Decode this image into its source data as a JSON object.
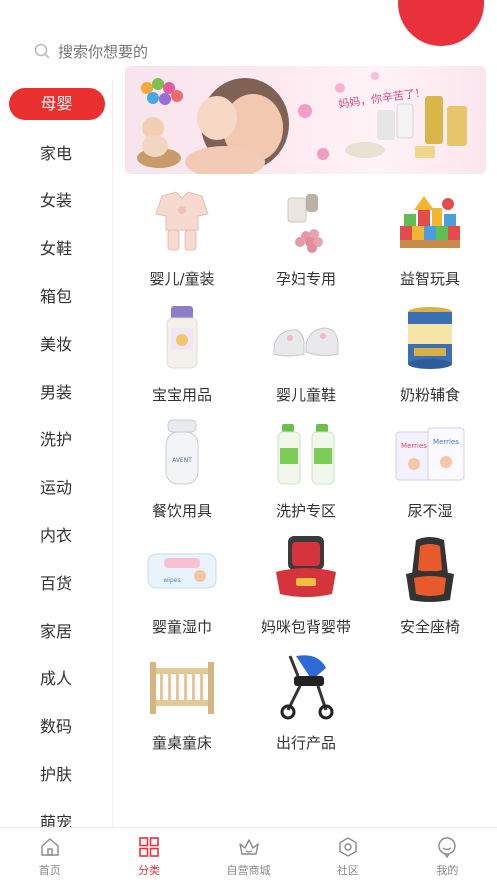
{
  "search": {
    "placeholder": "搜索你想要的",
    "button_label": "搜索"
  },
  "sidebar": {
    "items": [
      {
        "label": "母婴",
        "active": true
      },
      {
        "label": "家电"
      },
      {
        "label": "女装"
      },
      {
        "label": "女鞋"
      },
      {
        "label": "箱包"
      },
      {
        "label": "美妆"
      },
      {
        "label": "男装"
      },
      {
        "label": "洗护"
      },
      {
        "label": "运动"
      },
      {
        "label": "内衣"
      },
      {
        "label": "百货"
      },
      {
        "label": "家居"
      },
      {
        "label": "成人"
      },
      {
        "label": "数码"
      },
      {
        "label": "护肤"
      },
      {
        "label": "萌宠"
      }
    ]
  },
  "banner": {
    "slogan": "妈妈，你辛苦了！"
  },
  "grid": {
    "items": [
      {
        "label": "婴儿/童装",
        "icon": "baby-clothes-icon"
      },
      {
        "label": "孕妇专用",
        "icon": "maternity-supplement-icon"
      },
      {
        "label": "益智玩具",
        "icon": "building-blocks-icon"
      },
      {
        "label": "宝宝用品",
        "icon": "baby-lotion-icon"
      },
      {
        "label": "婴儿童鞋",
        "icon": "baby-shoes-icon"
      },
      {
        "label": "奶粉辅食",
        "icon": "milk-powder-can-icon"
      },
      {
        "label": "餐饮用具",
        "icon": "baby-bottle-icon"
      },
      {
        "label": "洗护专区",
        "icon": "detergent-bottles-icon"
      },
      {
        "label": "尿不湿",
        "icon": "diaper-pack-icon"
      },
      {
        "label": "婴童湿巾",
        "icon": "wet-wipes-icon"
      },
      {
        "label": "妈咪包背婴带",
        "icon": "baby-carrier-icon"
      },
      {
        "label": "安全座椅",
        "icon": "car-seat-icon"
      },
      {
        "label": "童桌童床",
        "icon": "baby-crib-icon"
      },
      {
        "label": "出行产品",
        "icon": "stroller-icon"
      }
    ]
  },
  "tabbar": {
    "items": [
      {
        "label": "首页",
        "icon": "home-icon"
      },
      {
        "label": "分类",
        "icon": "category-grid-icon",
        "active": true
      },
      {
        "label": "自营商城",
        "icon": "crown-shop-icon"
      },
      {
        "label": "社区",
        "icon": "community-hexagon-icon"
      },
      {
        "label": "我的",
        "icon": "profile-face-icon"
      }
    ]
  },
  "colors": {
    "accent": "#e8313b",
    "text": "#333333",
    "muted": "#8a8a8a"
  }
}
